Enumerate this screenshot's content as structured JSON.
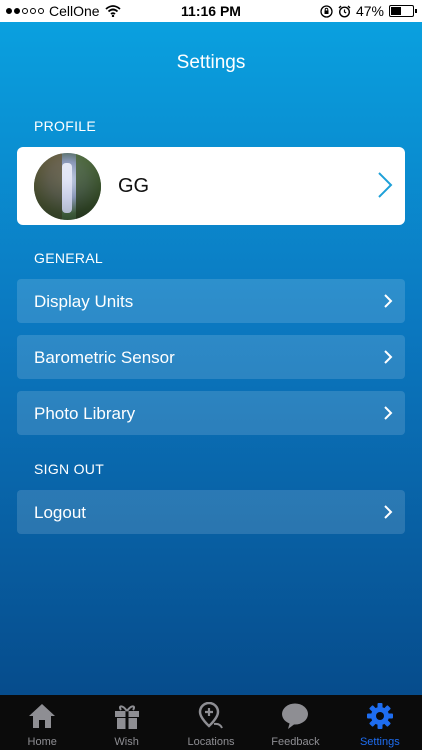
{
  "status_bar": {
    "carrier": "CellOne",
    "time": "11:16 PM",
    "battery": "47%",
    "battery_level": 0.47
  },
  "nav": {
    "title": "Settings"
  },
  "profile": {
    "header": "PROFILE",
    "name": "GG"
  },
  "general": {
    "header": "GENERAL",
    "items": [
      {
        "label": "Display Units"
      },
      {
        "label": "Barometric Sensor"
      },
      {
        "label": "Photo Library"
      }
    ]
  },
  "sign_out": {
    "header": "SIGN OUT",
    "logout_label": "Logout"
  },
  "tab_bar": {
    "tabs": [
      {
        "label": "Home",
        "icon": "home-icon"
      },
      {
        "label": "Wish",
        "icon": "gift-icon"
      },
      {
        "label": "Locations",
        "icon": "location-pin-icon"
      },
      {
        "label": "Feedback",
        "icon": "speech-bubble-icon"
      },
      {
        "label": "Settings",
        "icon": "gear-icon",
        "active": true
      }
    ]
  },
  "colors": {
    "gradient_top": "#0aa0df",
    "gradient_bottom": "#064c8c",
    "active_tab": "#1e6df0",
    "inactive_tab": "#8e8e93"
  }
}
